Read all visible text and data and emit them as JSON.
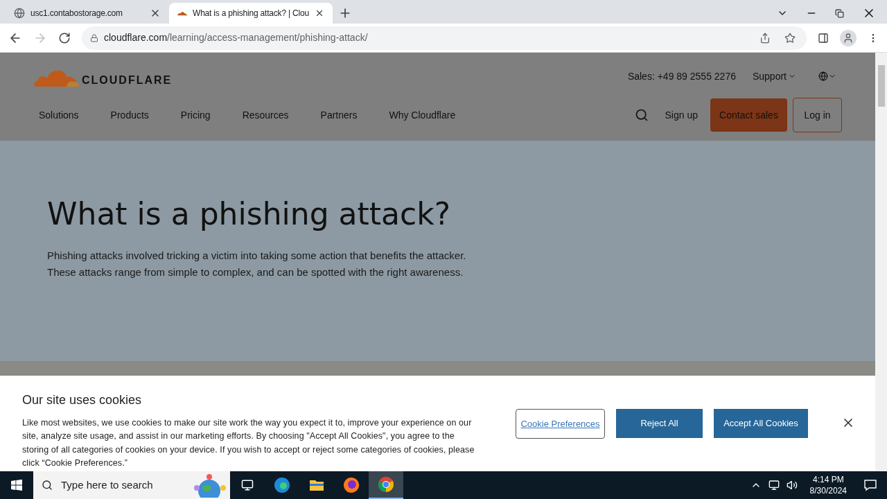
{
  "browser": {
    "tabs": [
      {
        "title": "usc1.contabostorage.com",
        "selected": false
      },
      {
        "title": "What is a phishing attack? | Clou",
        "selected": true
      }
    ],
    "address": {
      "domain": "cloudflare.com",
      "path": "/learning/access-management/phishing-attack/"
    }
  },
  "site": {
    "logo": "CLOUDFLARE",
    "sales": "Sales: +49 89 2555 2276",
    "support": "Support",
    "nav": [
      "Solutions",
      "Products",
      "Pricing",
      "Resources",
      "Partners",
      "Why Cloudflare"
    ],
    "sign_up": "Sign up",
    "contact": "Contact sales",
    "login": "Log in"
  },
  "hero": {
    "title": "What is a phishing attack?",
    "text": "Phishing attacks involved tricking a victim into taking some action that benefits the attacker. These attacks range from simple to complex, and can be spotted with the right awareness."
  },
  "cookies": {
    "title": "Our site uses cookies",
    "text": "Like most websites, we use cookies to make our site work the way you expect it to, improve your experience on our site, analyze site usage, and assist in our marketing efforts. By choosing \"Accept All Cookies\", you agree to the storing of all categories of cookies on your device. If you wish to accept or reject some categories of cookies, please click “Cookie Preferences.”",
    "preferences": "Cookie Preferences",
    "reject": "Reject All",
    "accept": "Accept All Cookies"
  },
  "taskbar": {
    "search": "Type here to search",
    "time": "4:14 PM",
    "date": "8/30/2024"
  }
}
